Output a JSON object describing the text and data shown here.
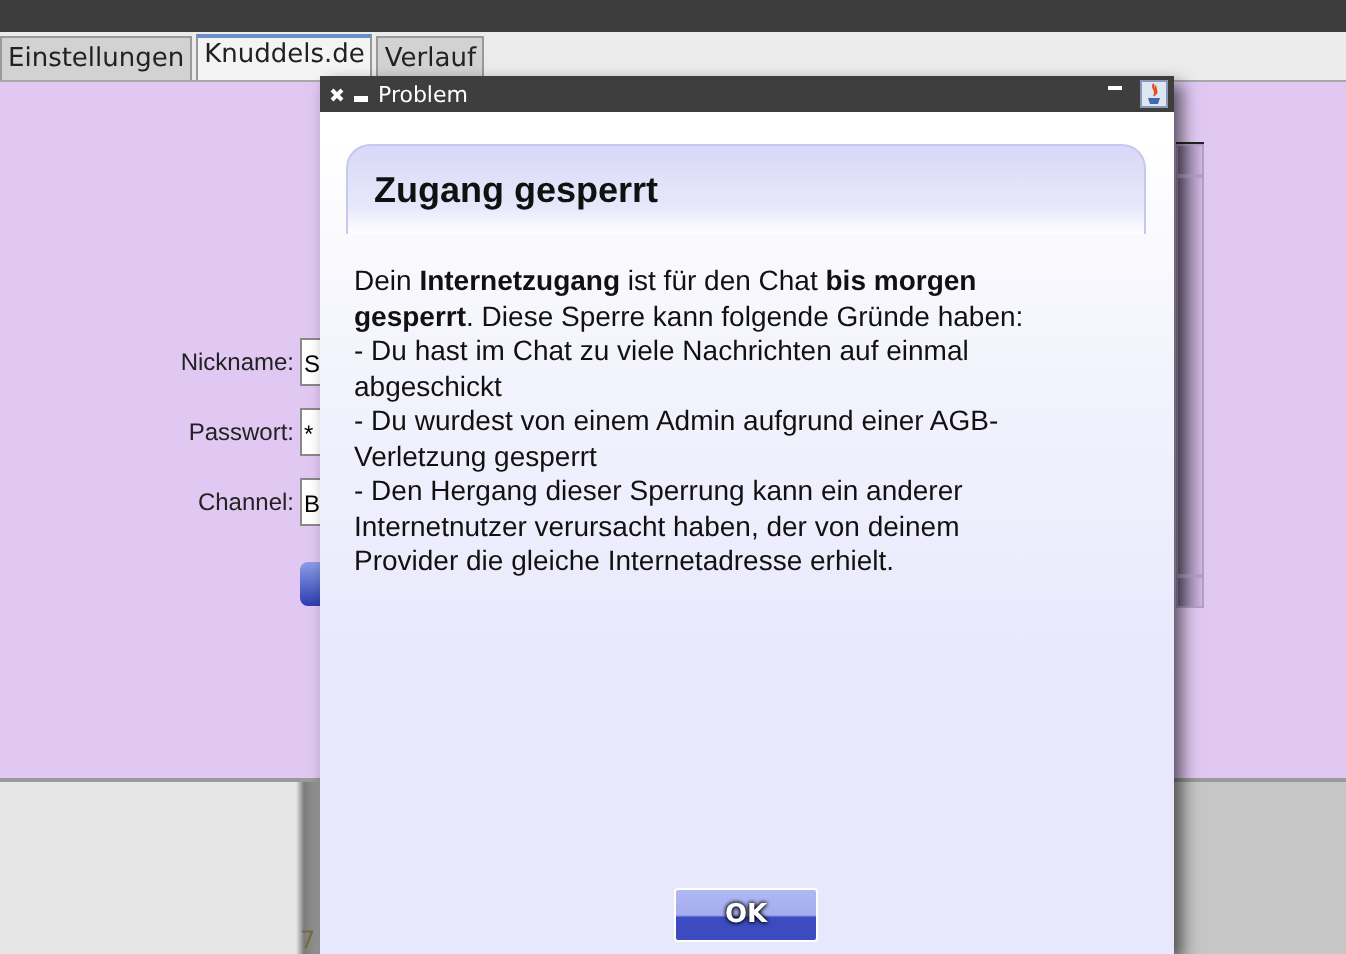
{
  "tabs": [
    {
      "label": "Einstellungen",
      "selected": false
    },
    {
      "label": "Knuddels.de",
      "selected": true
    },
    {
      "label": "Verlauf",
      "selected": false
    }
  ],
  "login_form": {
    "fields": [
      {
        "label": "Nickname:",
        "value": "S"
      },
      {
        "label": "Passwort:",
        "value": "*"
      },
      {
        "label": "Channel:",
        "value": "B"
      }
    ]
  },
  "background_text": "7",
  "dialog": {
    "title": "Problem",
    "heading": "Zugang gesperrt",
    "message": [
      "Dein **Internetzugang** ist für den Chat **bis morgen gesperrt**. Diese Sperre kann folgende Gründe haben:",
      "- Du hast im Chat zu viele Nachrichten auf einmal abgeschickt",
      "- Du wurdest von einem Admin aufgrund einer AGB-Verletzung gesperrt",
      "- Den Hergang dieser Sperrung kann ein anderer Internetnutzer verursacht haben, der von deinem Provider die gleiche Internetadresse erhielt."
    ],
    "button": "OK"
  }
}
